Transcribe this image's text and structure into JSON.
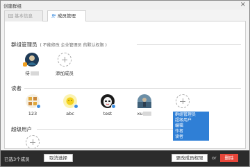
{
  "window": {
    "title": "创建群组",
    "close_glyph": "×"
  },
  "tabs": [
    {
      "label": "基本信息",
      "icon": "document-icon"
    },
    {
      "label": "成员管理",
      "icon": "people-icon"
    }
  ],
  "sections": {
    "admins": {
      "title": "群组管理员",
      "note": "( 不能修改 企业管理员 的默认权限 )"
    },
    "readers": {
      "title": "读者"
    },
    "superusers": {
      "title": "超级用户"
    }
  },
  "admins": [
    {
      "name": "侍",
      "badge": "admin"
    },
    {
      "name": "添加成员",
      "add": true
    }
  ],
  "readers": [
    {
      "name": "123",
      "avatar": "blocks-avatar"
    },
    {
      "name": "abc",
      "avatar": "sun-avatar"
    },
    {
      "name": "test",
      "avatar": "mask-avatar"
    },
    {
      "name": "xu",
      "avatar": "photo-avatar"
    }
  ],
  "role_menu": [
    "群组管理员",
    "超级用户",
    "编辑",
    "作者",
    "读者"
  ],
  "bottom": {
    "selected_count": "已选3个成员",
    "cancel_selection": "取消选择",
    "change_permission": "更改成员权限",
    "or": "or",
    "delete": "删除"
  },
  "colors": {
    "accent": "#2f7fd6",
    "delete": "#e8463a",
    "bottom_bar": "#2b2b2b"
  }
}
